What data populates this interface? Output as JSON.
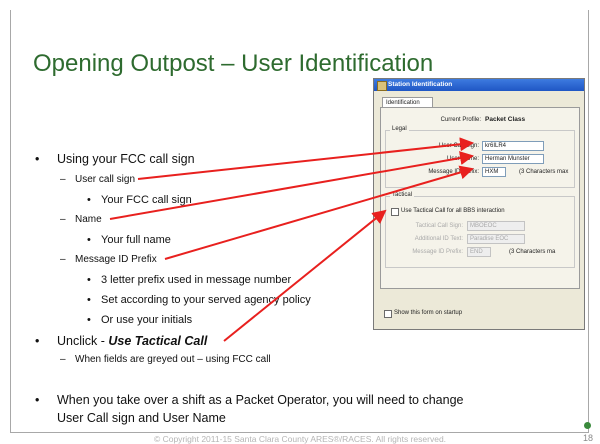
{
  "slide": {
    "title": "Opening Outpost – User Identification",
    "bullets": [
      {
        "text": "Using your FCC call sign"
      },
      {
        "text": "User call sign"
      },
      {
        "text": "Your FCC call sign"
      },
      {
        "text": "Name"
      },
      {
        "text": "Your full name"
      },
      {
        "text": "Message ID Prefix"
      },
      {
        "text": "3 letter prefix used in message number"
      },
      {
        "text": "Set according to your served agency policy"
      },
      {
        "text": "Or use your initials"
      },
      {
        "text": "Unclick  -",
        "emph": "Use Tactical Call"
      },
      {
        "text": "When fields are greyed out – using FCC call"
      },
      {
        "text": "When you take over a shift as a Packet Operator, you will need to change"
      },
      {
        "text": "User Call sign and User Name"
      }
    ],
    "footer": "© Copyright 2011-15 Santa Clara County ARES®/RACES. All rights reserved.",
    "page_number": "18",
    "bullet_marks": {
      "dot": "•",
      "dash": "–"
    },
    "colors": {
      "title": "#2e6b2f",
      "arrow": "#e8201e",
      "accent_dot": "#3a8a3c"
    }
  },
  "dialog": {
    "title": "Station Identification",
    "tab": "Identification",
    "current_profile_label": "Current Profile:",
    "current_profile_value": "Packet Class",
    "legal_label": "Legal",
    "user_call_sign_label": "User Call Sign:",
    "user_call_sign_value": "kr6ILR4",
    "user_name_label": "User Name:",
    "user_name_value": "Herman Munster",
    "message_id_prefix_label": "Message ID Prefix:",
    "message_id_prefix_value": "HXM",
    "message_id_hint": "(3 Characters max",
    "tactical_label": "Tactical",
    "use_tactical_label": "Use Tactical Call for all BBS interaction",
    "tactical_call_sign_label": "Tactical Call Sign:",
    "tactical_call_sign_value": "MBOEOC",
    "additional_id_label": "Additional ID Text:",
    "additional_id_value": "Paradise EOC",
    "tactical_prefix_label": "Message ID Prefix:",
    "tactical_prefix_value": "END",
    "tactical_hint": "(3 Characters ma",
    "show_on_startup_label": "Show this form on startup"
  }
}
